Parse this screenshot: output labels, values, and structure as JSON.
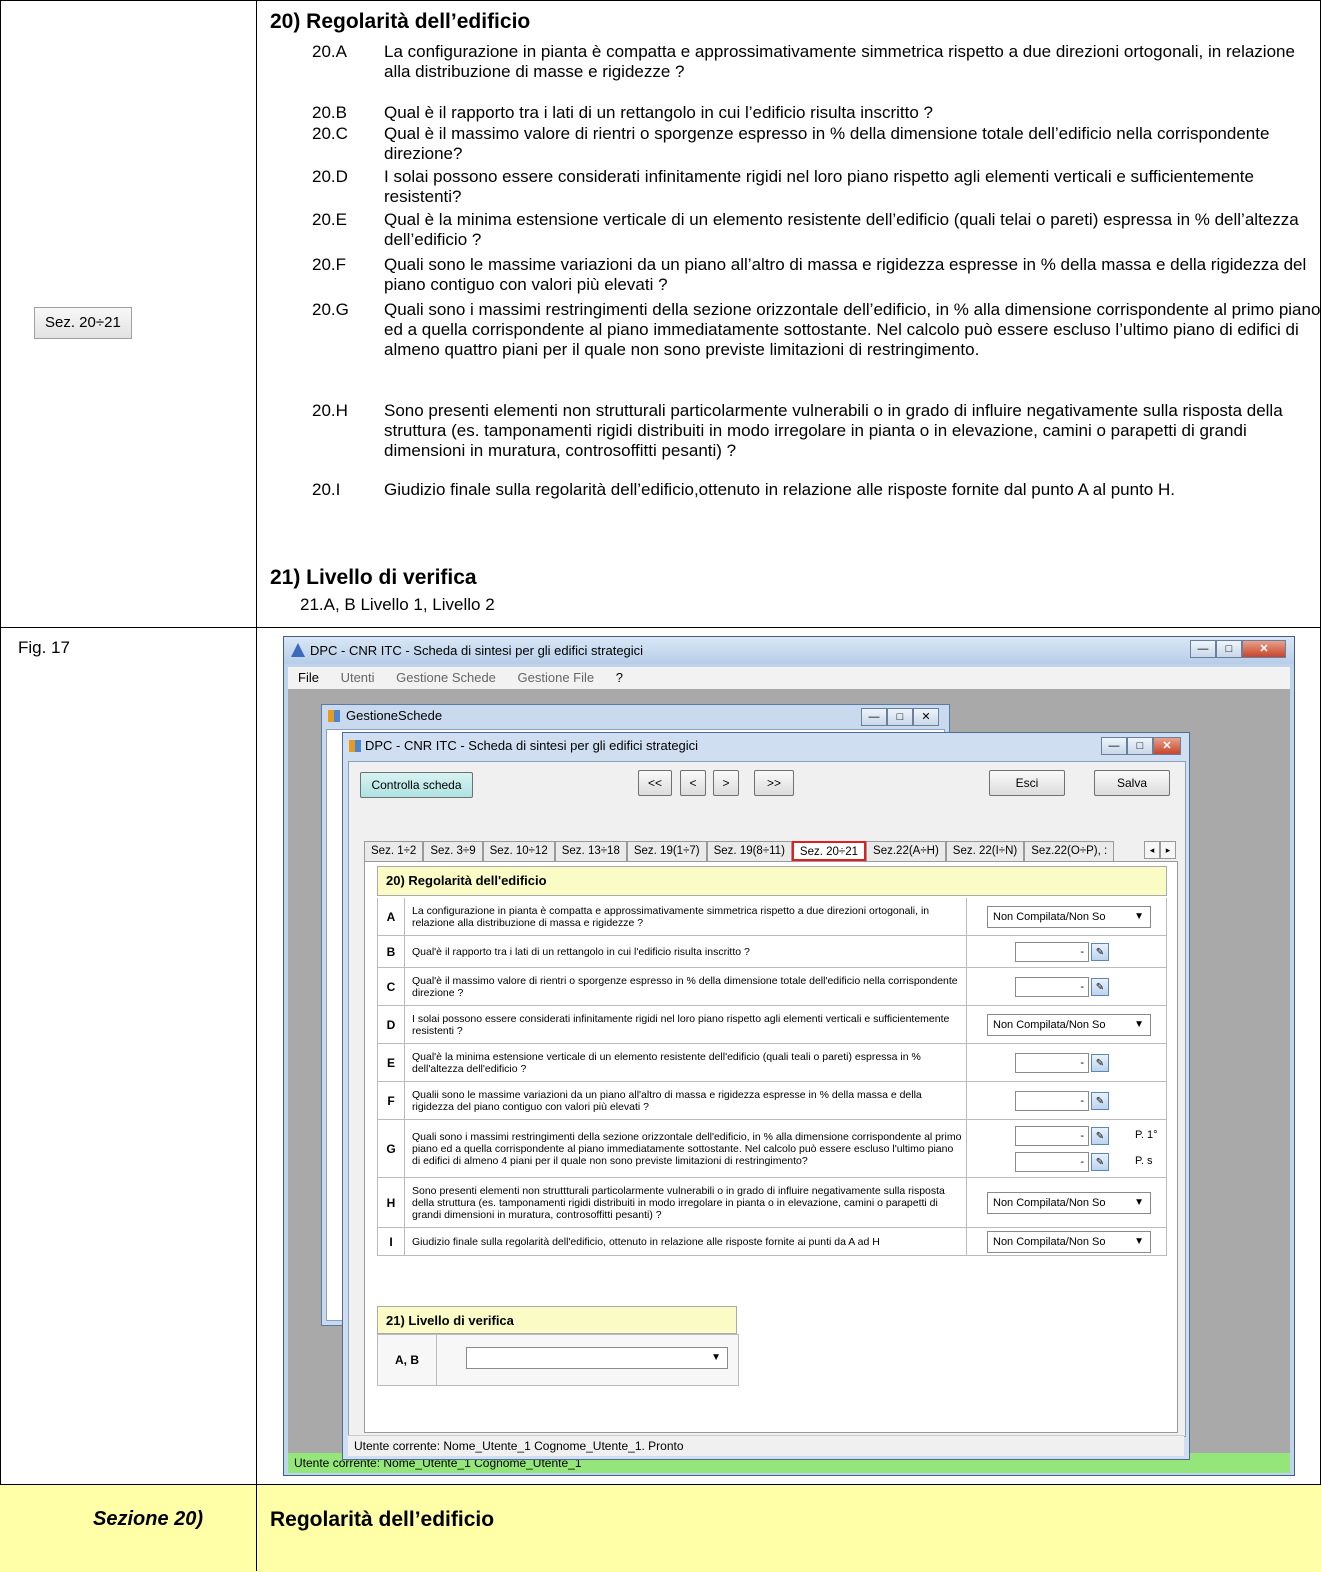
{
  "doc": {
    "section_badge": "Sez. 20÷21",
    "heading20": "20) Regolarità dell’edificio",
    "questions": [
      {
        "id": "20.A",
        "text": "La configurazione in pianta è compatta e approssimativamente simmetrica rispetto a due direzioni ortogonali, in relazione alla distribuzione di masse e rigidezze ?"
      },
      {
        "id": "20.B",
        "text": "Qual è il rapporto tra i lati di un rettangolo in cui l’edificio risulta inscritto ?"
      },
      {
        "id": "20.C",
        "text": "Qual è il massimo valore di rientri o sporgenze espresso in % della dimensione totale dell’edificio nella corrispondente direzione?"
      },
      {
        "id": "20.D",
        "text": "I solai possono essere considerati infinitamente rigidi nel loro piano rispetto agli elementi verticali e sufficientemente resistenti?"
      },
      {
        "id": "20.E",
        "text": "Qual è la minima estensione verticale di un elemento resistente dell’edificio (quali telai o pareti) espressa in % dell’altezza dell’edificio ?"
      },
      {
        "id": "20.F",
        "text": "Quali sono le massime variazioni da un piano all’altro di massa e rigidezza espresse in % della massa e della rigidezza del piano contiguo con valori più elevati ?"
      },
      {
        "id": "20.G",
        "text": "Quali sono i massimi restringimenti della sezione orizzontale dell’edificio, in % alla  dimensione corrispondente al primo piano ed a quella corrispondente al piano immediatamente sottostante. Nel calcolo può essere escluso  l’ultimo piano di edifici di almeno quattro piani per il quale non sono previste limitazioni di restringimento."
      },
      {
        "id": "20.H",
        "text": "Sono presenti elementi non strutturali particolarmente vulnerabili o in  grado di influire negativamente sulla risposta della struttura (es. tamponamenti rigidi distribuiti in modo irregolare in pianta o in elevazione, camini o parapetti di grandi dimensioni in muratura, controsoffitti pesanti) ?"
      },
      {
        "id": "20.I",
        "text": "Giudizio finale sulla regolarità dell’edificio,ottenuto in relazione alle risposte fornite dal punto A al punto H."
      }
    ],
    "heading21": "21) Livello di verifica",
    "line21": "21.A, B Livello 1, Livello 2",
    "fig_label": "Fig. 17",
    "bottom_left": "Sezione 20)",
    "bottom_right": "Regolarità dell’edificio"
  },
  "app": {
    "title": "DPC - CNR ITC - Scheda di sintesi per gli edifici strategici",
    "menu": [
      "File",
      "Utenti",
      "Gestione Schede",
      "Gestione File",
      "?"
    ],
    "status": "Utente corrente: Nome_Utente_1 Cognome_Utente_1",
    "gestione_title": "GestioneSchede",
    "inner_title": "DPC - CNR ITC - Scheda di sintesi per gli edifici strategici",
    "inner_status": "Utente corrente: Nome_Utente_1 Cognome_Utente_1. Pronto",
    "btn_controlla": "Controlla scheda",
    "nav": [
      "<<",
      "<",
      ">",
      ">>"
    ],
    "btn_esci": "Esci",
    "btn_salva": "Salva",
    "tabs": [
      "Sez. 1÷2",
      "Sez. 3÷9",
      "Sez. 10÷12",
      "Sez. 13÷18",
      "Sez. 19(1÷7)",
      "Sez. 19(8÷11)",
      "Sez. 20÷21",
      "Sez.22(A÷H)",
      "Sez. 22(I÷N)",
      "Sez.22(O÷P), :"
    ],
    "selected_tab": "Sez. 20÷21",
    "form_heading20": "20) Regolarità dell'edificio",
    "form_rows": [
      {
        "letter": "A",
        "text": "La configurazione in pianta è compatta e approssimativamente simmetrica rispetto a due direzioni ortogonali, in relazione alla distribuzione di massa e rigidezze ?",
        "combo": "Non Compilata/Non So"
      },
      {
        "letter": "B",
        "text": "Qual'è il rapporto tra i lati di un rettangolo in cui l'edificio risulta inscritto ?",
        "num": "-"
      },
      {
        "letter": "C",
        "text": "Qual'è il massimo valore di rientri o sporgenze espresso in % della dimensione totale dell'edificio nella corrispondente direzione ?",
        "num": "-"
      },
      {
        "letter": "D",
        "text": "I solai possono essere considerati infinitamente rigidi nel loro piano rispetto agli elementi verticali e sufficientemente resistenti ?",
        "combo": "Non Compilata/Non So"
      },
      {
        "letter": "E",
        "text": "Qual'è la minima estensione verticale di un elemento resistente dell'edificio (quali teali o pareti) espressa in % dell'altezza dell'edificio ?",
        "num": "-"
      },
      {
        "letter": "F",
        "text": "Qualii sono le massime variazioni da un piano all'altro di massa e rigidezza espresse in % della massa e della rigidezza del piano contiguo con valori più elevati ?",
        "num": "-"
      },
      {
        "letter": "G",
        "text": "Quali sono i massimi restringimenti della sezione orizzontale dell'edificio, in % alla dimensione corrispondente al primo piano ed a quella corrispondente al piano immediatamente sottostante. Nel calcolo può essere escluso l'ultimo piano di edifici di almeno 4 piani per il quale non sono previste limitazioni di restringimento?",
        "num": "-",
        "num2": "-",
        "p1": "P. 1°",
        "p2": "P. s"
      },
      {
        "letter": "H",
        "text": "Sono presenti elementi non struttturali particolarmente vulnerabili o in grado di influire negativamente sulla risposta della struttura (es. tamponamenti rigidi distribuiti in modo irregolare in pianta o in elevazione, camini o parapetti di grandi dimensioni in muratura, controsoffitti pesanti) ?",
        "combo": "Non Compilata/Non So"
      },
      {
        "letter": "I",
        "text": "Giudizio finale sulla regolarità dell'edificio, ottenuto in relazione alle risposte fornite ai punti da A ad H",
        "combo": "Non Compilata/Non So"
      }
    ],
    "form_heading21": "21) Livello di verifica",
    "ab_label": "A, B",
    "ab_value": ""
  }
}
